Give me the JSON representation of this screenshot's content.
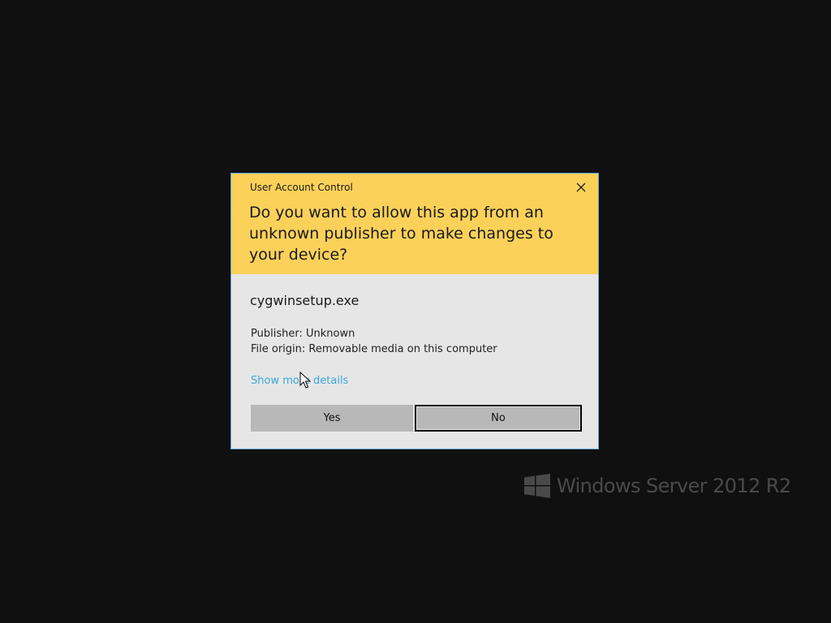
{
  "dialog": {
    "title": "User Account Control",
    "question": "Do you want to allow this app from an unknown publisher to make changes to your device?",
    "app_name": "cygwinsetup.exe",
    "publisher": "Publisher: Unknown",
    "file_origin": "File origin: Removable media on this computer",
    "show_more": "Show more details",
    "yes_label": "Yes",
    "no_label": "No"
  },
  "branding": {
    "text": "Windows Server 2012 R2",
    "logo_icon": "windows-logo-icon"
  },
  "icons": {
    "close": "close-icon",
    "cursor": "mouse-pointer-icon"
  },
  "colors": {
    "background": "#101010",
    "header": "#fcd15a",
    "body": "#e6e6e6",
    "link": "#3aa8db",
    "button": "#b8b8b8",
    "brand_text": "#4a4a4a"
  }
}
